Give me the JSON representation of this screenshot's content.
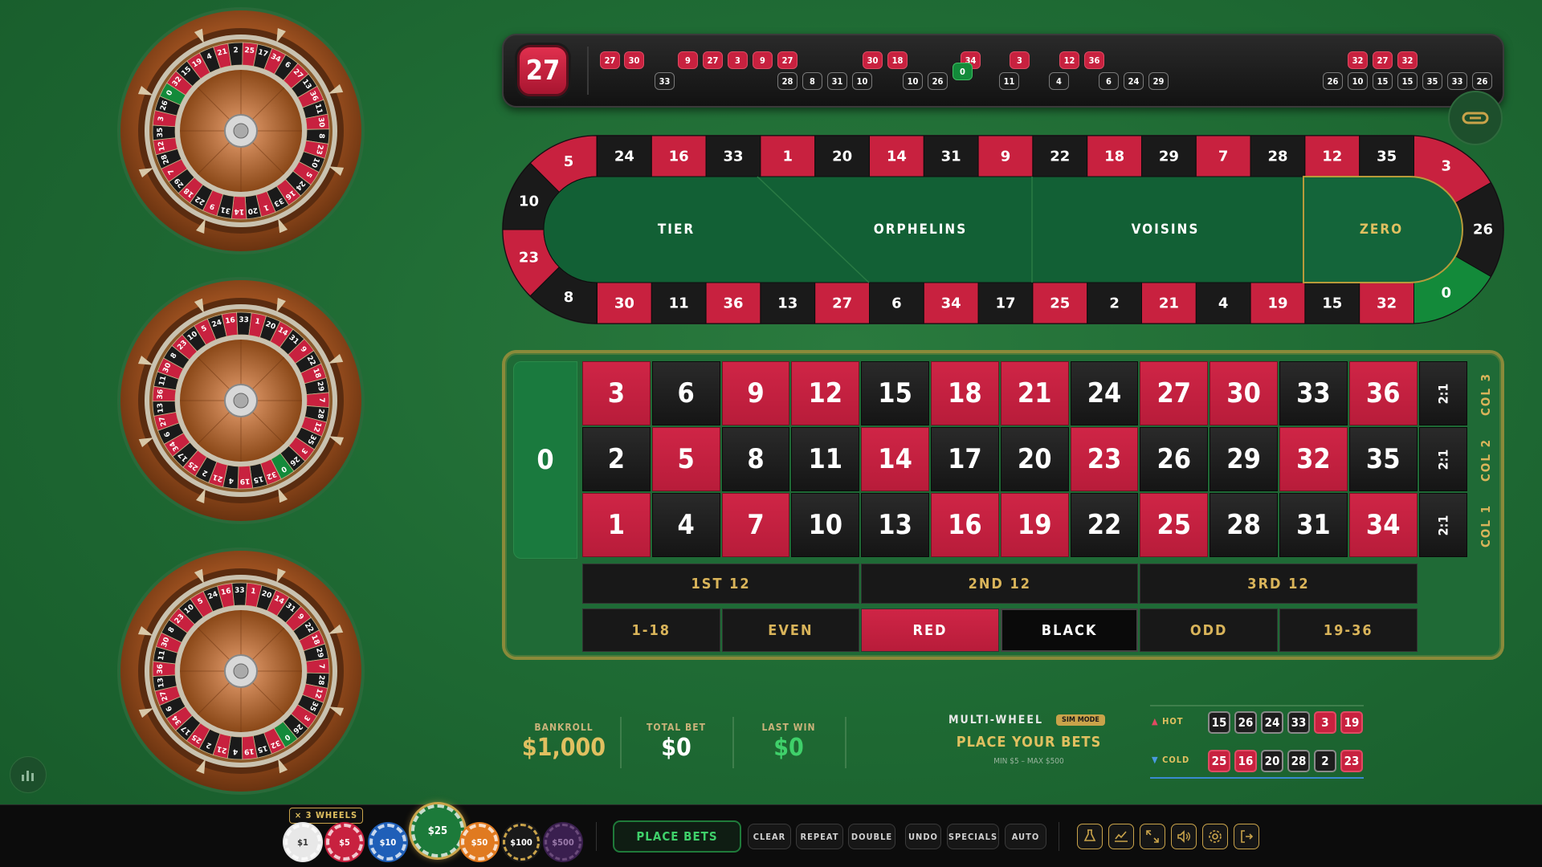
{
  "history": {
    "last_number": "27",
    "top": [
      {
        "n": "27",
        "c": "red"
      },
      {
        "n": "30",
        "c": "red"
      },
      {
        "n": "9",
        "c": "red"
      },
      {
        "n": "27",
        "c": "red"
      },
      {
        "n": "3",
        "c": "red"
      },
      {
        "n": "9",
        "c": "red"
      },
      {
        "n": "27",
        "c": "red"
      },
      {
        "n": "30",
        "c": "red"
      },
      {
        "n": "18",
        "c": "red"
      },
      {
        "n": "34",
        "c": "red"
      },
      {
        "n": "3",
        "c": "red"
      },
      {
        "n": "12",
        "c": "red"
      },
      {
        "n": "36",
        "c": "red"
      },
      {
        "n": "32",
        "c": "red"
      },
      {
        "n": "27",
        "c": "red"
      },
      {
        "n": "32",
        "c": "red"
      }
    ],
    "bottom": [
      {
        "n": "33",
        "c": "black"
      },
      {
        "n": "28",
        "c": "black"
      },
      {
        "n": "8",
        "c": "black"
      },
      {
        "n": "31",
        "c": "black"
      },
      {
        "n": "10",
        "c": "black"
      },
      {
        "n": "10",
        "c": "black"
      },
      {
        "n": "26",
        "c": "black"
      },
      {
        "n": "0",
        "c": "green"
      },
      {
        "n": "11",
        "c": "black"
      },
      {
        "n": "4",
        "c": "black"
      },
      {
        "n": "6",
        "c": "black"
      },
      {
        "n": "24",
        "c": "black"
      },
      {
        "n": "29",
        "c": "black"
      },
      {
        "n": "26",
        "c": "black"
      },
      {
        "n": "10",
        "c": "black"
      },
      {
        "n": "15",
        "c": "black"
      },
      {
        "n": "15",
        "c": "black"
      },
      {
        "n": "35",
        "c": "black"
      },
      {
        "n": "33",
        "c": "black"
      },
      {
        "n": "26",
        "c": "black"
      }
    ]
  },
  "racetrack": {
    "top_row": [
      "24",
      "16",
      "33",
      "1",
      "20",
      "14",
      "31",
      "9",
      "22",
      "18",
      "29",
      "7",
      "28",
      "12",
      "35"
    ],
    "bottom_row": [
      "30",
      "11",
      "36",
      "13",
      "27",
      "6",
      "34",
      "17",
      "25",
      "2",
      "21",
      "4",
      "19",
      "15",
      "32"
    ],
    "left_cap": [
      "5",
      "10",
      "23",
      "8"
    ],
    "right_cap": [
      "3",
      "26",
      "0"
    ],
    "sections": {
      "tier": "TIER",
      "orphelins": "ORPHELINS",
      "voisins": "VOISINS",
      "zero": "ZERO"
    }
  },
  "table": {
    "zero": "0",
    "row3": [
      "3",
      "6",
      "9",
      "12",
      "15",
      "18",
      "21",
      "24",
      "27",
      "30",
      "33",
      "36"
    ],
    "row2": [
      "2",
      "5",
      "8",
      "11",
      "14",
      "17",
      "20",
      "23",
      "26",
      "29",
      "32",
      "35"
    ],
    "row1": [
      "1",
      "4",
      "7",
      "10",
      "13",
      "16",
      "19",
      "22",
      "25",
      "28",
      "31",
      "34"
    ],
    "column_bet": "2:1",
    "col_labels": [
      "COL 3",
      "COL 2",
      "COL 1"
    ],
    "dozens": [
      "1ST 12",
      "2ND 12",
      "3RD 12"
    ],
    "outside": [
      "1-18",
      "EVEN",
      "RED",
      "BLACK",
      "ODD",
      "19-36"
    ],
    "red_numbers": [
      "1",
      "3",
      "5",
      "7",
      "9",
      "12",
      "14",
      "16",
      "18",
      "19",
      "21",
      "23",
      "25",
      "27",
      "30",
      "32",
      "34",
      "36"
    ]
  },
  "stats": {
    "bankroll_label": "BANKROLL",
    "bankroll": "$1,000",
    "total_bet_label": "TOTAL BET",
    "total_bet": "$0",
    "last_win_label": "LAST WIN",
    "last_win": "$0"
  },
  "status": {
    "mode_title": "MULTI-WHEEL",
    "mode_badge": "SIM MODE",
    "message": "PLACE YOUR BETS",
    "limits": "MIN $5 – MAX $500"
  },
  "hot_cold": {
    "hot_label": "HOT",
    "hot": [
      {
        "n": "15",
        "c": "black"
      },
      {
        "n": "26",
        "c": "black"
      },
      {
        "n": "24",
        "c": "black"
      },
      {
        "n": "33",
        "c": "black"
      },
      {
        "n": "3",
        "c": "red"
      },
      {
        "n": "19",
        "c": "red"
      }
    ],
    "cold_label": "COLD",
    "cold": [
      {
        "n": "25",
        "c": "red"
      },
      {
        "n": "16",
        "c": "red"
      },
      {
        "n": "20",
        "c": "black"
      },
      {
        "n": "28",
        "c": "black"
      },
      {
        "n": "2",
        "c": "black"
      },
      {
        "n": "23",
        "c": "red"
      }
    ]
  },
  "controls": {
    "wheels_badge": "× 3 WHEELS",
    "chips": [
      {
        "label": "$1",
        "color": "#e8e8e8",
        "text": "#333"
      },
      {
        "label": "$5",
        "color": "#c8213f",
        "text": "#fff"
      },
      {
        "label": "$10",
        "color": "#1f5fb8",
        "text": "#fff"
      },
      {
        "label": "$25",
        "color": "#1c7a3a",
        "text": "#fff"
      },
      {
        "label": "$50",
        "color": "#e07a20",
        "text": "#fff"
      },
      {
        "label": "$100",
        "color": "#1a1a1a",
        "text": "#fff"
      },
      {
        "label": "$500",
        "color": "#3a1f4f",
        "text": "#9a7aaa"
      }
    ],
    "place_bets": "PLACE BETS",
    "buttons": [
      "CLEAR",
      "REPEAT",
      "DOUBLE",
      "UNDO",
      "SPECIALS",
      "AUTO"
    ],
    "icons": [
      "flask-icon",
      "chart-line-icon",
      "expand-icon",
      "volume-icon",
      "gear-icon",
      "exit-icon"
    ]
  },
  "wheel_sequence": [
    "0",
    "32",
    "15",
    "19",
    "4",
    "21",
    "2",
    "25",
    "17",
    "34",
    "6",
    "27",
    "13",
    "36",
    "11",
    "30",
    "8",
    "23",
    "10",
    "5",
    "24",
    "16",
    "33",
    "1",
    "20",
    "14",
    "31",
    "9",
    "22",
    "18",
    "29",
    "7",
    "28",
    "12",
    "35",
    "3",
    "26"
  ],
  "colors": {
    "red": "#c8213f",
    "black": "#1a1a1a",
    "green": "#138a3a",
    "gold": "#d9b45a",
    "felt": "#1f6b34"
  }
}
